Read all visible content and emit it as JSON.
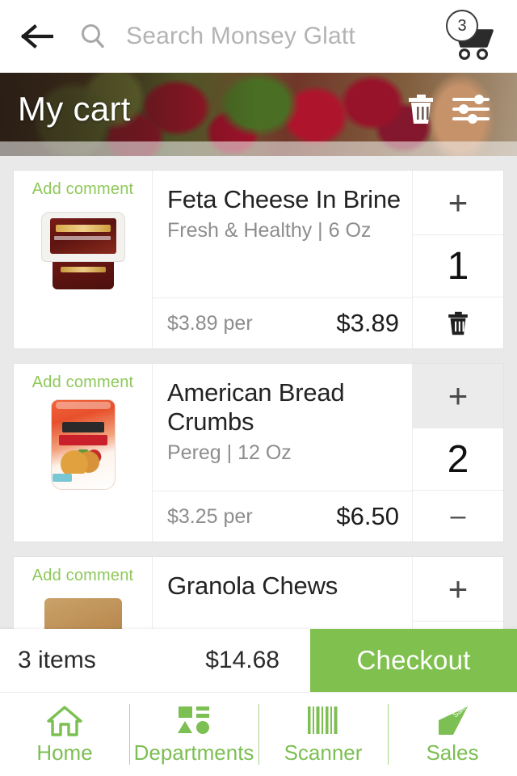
{
  "topbar": {
    "back_icon": "arrow-left-icon",
    "search_icon": "search-icon",
    "search_placeholder": "Search Monsey Glatt",
    "search_value": "",
    "cart_icon": "shopping-cart-icon",
    "cart_badge_count": "3"
  },
  "banner": {
    "title": "My cart",
    "delete_all_icon": "trash-icon",
    "filter_icon": "sliders-icon"
  },
  "cart": {
    "add_comment_label": "Add comment",
    "items": [
      {
        "name": "Feta Cheese In Brine",
        "subtitle": "Fresh & Healthy | 6 Oz",
        "brand": "Fresh & Healthy",
        "size": "6 Oz",
        "unit_price_label": "$3.89 per",
        "total_price": "$3.89",
        "quantity": "1",
        "plus_label": "+",
        "decrement_type": "trash-icon",
        "minus_label": "",
        "plus_active": false,
        "image": "feta-tub"
      },
      {
        "name": "American Bread Crumbs",
        "subtitle": "Pereg | 12 Oz",
        "brand": "Pereg",
        "size": "12 Oz",
        "unit_price_label": "$3.25 per",
        "total_price": "$6.50",
        "quantity": "2",
        "plus_label": "+",
        "decrement_type": "minus",
        "minus_label": "–",
        "plus_active": true,
        "image": "breadcrumbs-pouch"
      },
      {
        "name": "Granola Chews",
        "subtitle": "",
        "brand": "",
        "size": "",
        "unit_price_label": "",
        "total_price": "",
        "quantity": "",
        "plus_label": "+",
        "decrement_type": "minus",
        "minus_label": "",
        "plus_active": false,
        "image": "granola-box"
      }
    ]
  },
  "checkout": {
    "items_count_label": "3 items",
    "total_label": "$14.68",
    "button_label": "Checkout"
  },
  "bottom_nav": [
    {
      "label": "Home",
      "icon": "home-icon"
    },
    {
      "label": "Departments",
      "icon": "departments-grid-icon"
    },
    {
      "label": "Scanner",
      "icon": "barcode-icon"
    },
    {
      "label": "Sales",
      "icon": "sale-tag-icon"
    }
  ],
  "colors": {
    "accent_green": "#7fc04e",
    "nav_green": "#7cbf52",
    "comment_green": "#8fc85a",
    "page_bg": "#e9e9e9",
    "card_bg": "#ffffff",
    "plus_active_bg": "#ebebeb"
  }
}
